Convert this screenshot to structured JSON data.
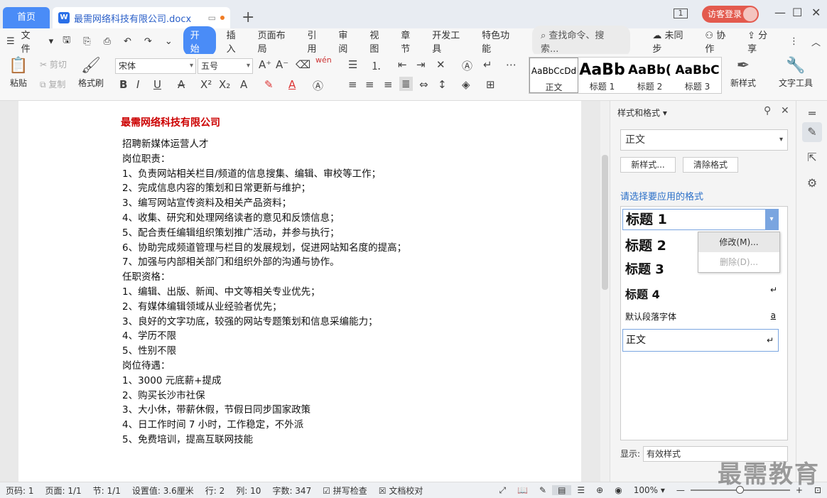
{
  "titlebar": {
    "home_tab": "首页",
    "doc_tab": "最需网络科技有限公司.docx",
    "doc_icon": "W",
    "guest_login": "访客登录",
    "page_badge": "1"
  },
  "menu": {
    "file": "文件",
    "items": [
      "开始",
      "插入",
      "页面布局",
      "引用",
      "审阅",
      "视图",
      "章节",
      "开发工具",
      "特色功能"
    ],
    "search": "查找命令、搜索...",
    "unsynced": "未同步",
    "collab": "协作",
    "share": "分享"
  },
  "ribbon": {
    "paste": "粘贴",
    "cut": "剪切",
    "copy": "复制",
    "format_painter": "格式刷",
    "font_name": "宋体",
    "font_size": "五号",
    "wen": "wén",
    "styles": [
      {
        "preview": "AaBbCcDd",
        "label": "正文"
      },
      {
        "preview": "AaBb",
        "label": "标题 1"
      },
      {
        "preview": "AaBb(",
        "label": "标题 2"
      },
      {
        "preview": "AaBbC",
        "label": "标题 3"
      }
    ],
    "new_style": "新样式",
    "text_tools": "文字工具"
  },
  "document": {
    "title": "最需网络科技有限公司",
    "lines": [
      "招聘新媒体运营人才",
      "岗位职责：",
      "1、负责网站相关栏目/频道的信息搜集、编辑、审校等工作；",
      "2、完成信息内容的策划和日常更新与维护；",
      "3、编写网站宣传资料及相关产品资料；",
      "4、收集、研究和处理网络读者的意见和反馈信息；",
      "5、配合责任编辑组织策划推广活动，并参与执行；",
      "6、协助完成频道管理与栏目的发展规划，促进网站知名度的提高；",
      "7、加强与内部相关部门和组织外部的沟通与协作。",
      "任职资格：",
      "1、编辑、出版、新闻、中文等相关专业优先；",
      "2、有媒体编辑领域从业经验者优先；",
      "3、良好的文字功底，较强的网站专题策划和信息采编能力；",
      "4、学历不限",
      "5、性别不限",
      "岗位待遇：",
      "1、3000 元底薪+提成",
      "2、购买长沙市社保",
      "3、大小休，带薪休假，节假日同步国家政策",
      "4、日工作时间 7 小时，工作稳定，不外派",
      "5、免费培训，提高互联网技能"
    ]
  },
  "pane": {
    "title": "样式和格式",
    "current_style": "正文",
    "new_style_btn": "新样式...",
    "clear_format_btn": "清除格式",
    "hint": "请选择要应用的格式",
    "styles": [
      {
        "name": "标题  1"
      },
      {
        "name": "标题  2"
      },
      {
        "name": "标题  3"
      },
      {
        "name": "标题  4"
      },
      {
        "name": "默认段落字体"
      },
      {
        "name": "正文"
      }
    ],
    "context_menu": {
      "modify": "修改(M)...",
      "delete": "删除(D)..."
    },
    "show_label": "显示:",
    "show_value": "有效样式"
  },
  "statusbar": {
    "page": "页码: 1",
    "pages": "页面: 1/1",
    "section": "节: 1/1",
    "setting": "设置值: 3.6厘米",
    "row": "行: 2",
    "col": "列: 10",
    "words": "字数: 347",
    "spellcheck": "拼写检查",
    "proofread": "文档校对",
    "zoom": "100%"
  },
  "watermark": "最需教育",
  "colors": {
    "accent": "#4a8cf7",
    "title_red": "#cc0000",
    "guest": "#e35a4e",
    "hint_blue": "#2a6fc8"
  }
}
